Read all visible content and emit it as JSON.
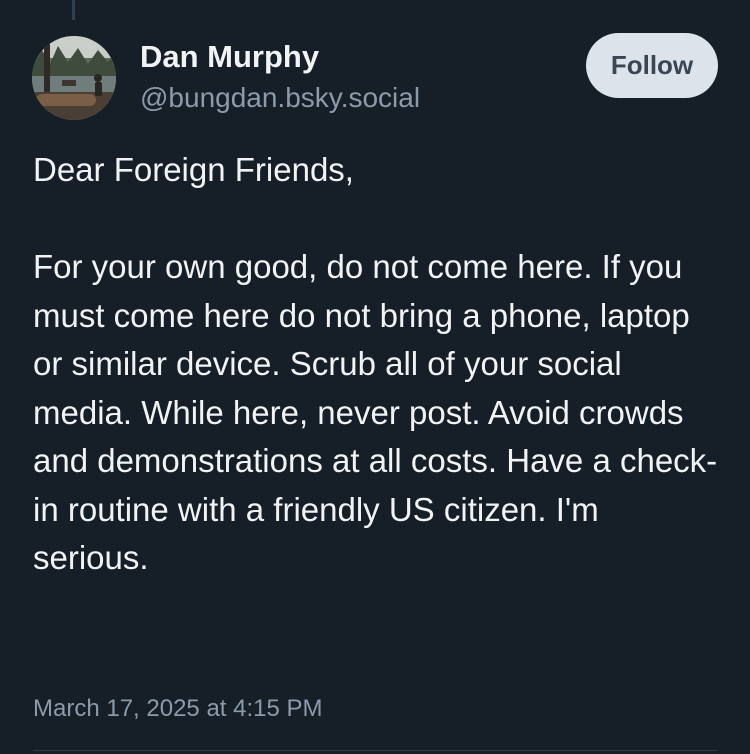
{
  "author": {
    "display_name": "Dan Murphy",
    "handle": "@bungdan.bsky.social",
    "avatar_icon": "person-photo-avatar"
  },
  "follow_button": {
    "label": "Follow"
  },
  "post": {
    "text": "Dear Foreign Friends,\n\nFor your own good, do not come here. If you must come here do not bring a phone, laptop or similar device. Scrub all of your social media. While here, never post. Avoid crowds and demonstrations at all costs. Have a check-in routine with a friendly US citizen. I'm serious.",
    "timestamp": "March 17, 2025 at 4:15 PM"
  },
  "colors": {
    "background": "#161e27",
    "primary_text": "#f1f3f5",
    "secondary_text": "#8c9baa",
    "follow_button_bg": "#dde3ea",
    "follow_button_text": "#3a4653"
  }
}
